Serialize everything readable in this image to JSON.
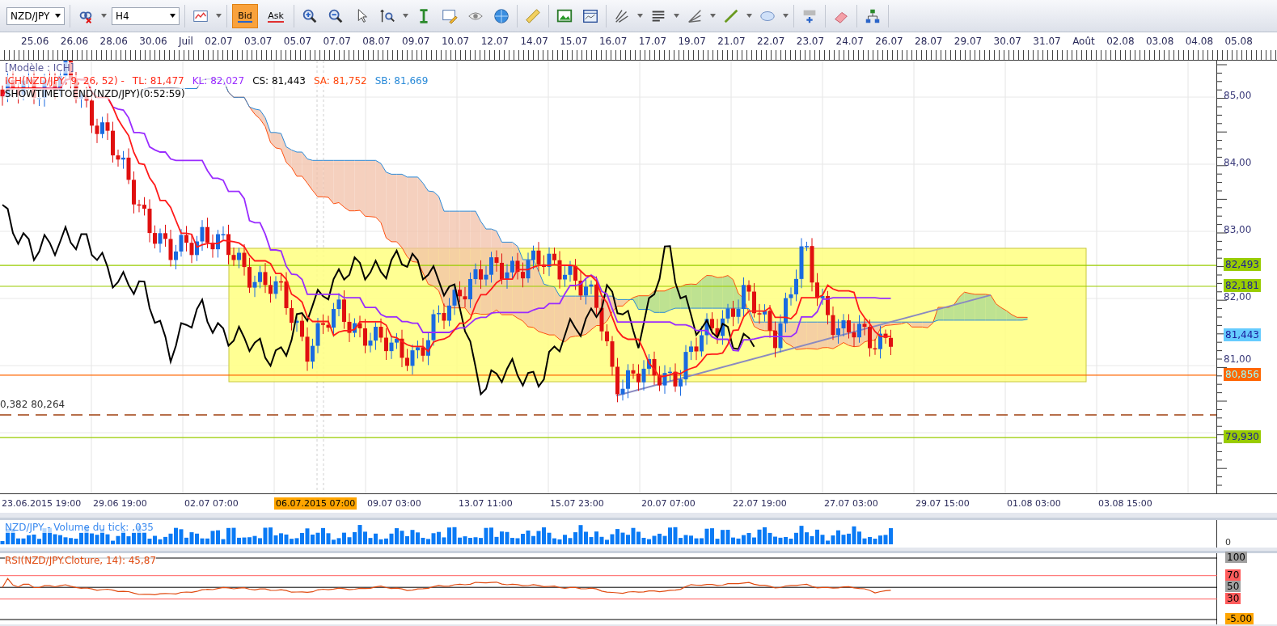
{
  "toolbar": {
    "symbol": "NZD/JPY",
    "timeframe": "H4",
    "price_buttons": [
      {
        "label": "Bid",
        "selected": true
      },
      {
        "label": "Ask",
        "selected": false
      }
    ]
  },
  "date_axis": [
    "25.06",
    "26.06",
    "28.06",
    "30.06",
    "Juil",
    "02.07",
    "03.07",
    "05.07",
    "07.07",
    "08.07",
    "09.07",
    "10.07",
    "12.07",
    "14.07",
    "15.07",
    "16.07",
    "17.07",
    "19.07",
    "21.07",
    "22.07",
    "23.07",
    "24.07",
    "26.07",
    "28.07",
    "29.07",
    "30.07",
    "31.07",
    "Août",
    "02.08",
    "03.08",
    "04.08",
    "05.08"
  ],
  "legend": {
    "template": "[Modèle : ICH]",
    "values": [
      {
        "text": "ICH(NZD/JPY, 9, 26, 52) -",
        "color": "#ff2a1a"
      },
      {
        "text": "TL: 81,477",
        "color": "#ff2a1a"
      },
      {
        "text": "KL: 82,027",
        "color": "#9a2cff"
      },
      {
        "text": "CS: 81,443",
        "color": "#000000"
      },
      {
        "text": "SA: 81,752",
        "color": "#ff4a10"
      },
      {
        "text": "SB: 81,669",
        "color": "#2a8ad8"
      }
    ],
    "timer": "SHOWTIMETOEND(NZD/JPY)(0:52:59)"
  },
  "price_axis": [
    "85,00",
    "84,00",
    "83,00",
    "82,00",
    "81,00"
  ],
  "price_levels": [
    {
      "text": "82,493",
      "color": "#99cc00"
    },
    {
      "text": "82,181",
      "color": "#99cc00"
    },
    {
      "text": "81,443",
      "color": "#66ccff"
    },
    {
      "text": "80,856",
      "color": "#ff6600"
    },
    {
      "text": "79,930",
      "color": "#99cc00"
    }
  ],
  "fibo_label": "0,382 80,264",
  "time_axis": [
    {
      "text": "23.06.2015 19:00",
      "selected": false
    },
    {
      "text": "29.06 19:00",
      "selected": false
    },
    {
      "text": "02.07 07:00",
      "selected": false
    },
    {
      "text": "06.07.2015 07:00",
      "selected": true
    },
    {
      "text": "09.07 03:00",
      "selected": false
    },
    {
      "text": "13.07 11:00",
      "selected": false
    },
    {
      "text": "15.07 23:00",
      "selected": false
    },
    {
      "text": "20.07 07:00",
      "selected": false
    },
    {
      "text": "22.07 19:00",
      "selected": false
    },
    {
      "text": "27.07 03:00",
      "selected": false
    },
    {
      "text": "29.07 15:00",
      "selected": false
    },
    {
      "text": "01.08 03:00",
      "selected": false
    },
    {
      "text": "03.08 15:00",
      "selected": false
    }
  ],
  "volume_panel": {
    "title": "NZD/JPY - Volume du tick: ,035",
    "axis": [
      "0"
    ]
  },
  "rsi_panel": {
    "title": "RSI(NZD/JPY.Cloture, 14): 45,87",
    "axis": [
      {
        "text": "100",
        "color": "#a0a0a0"
      },
      {
        "text": "70",
        "color": "#ff5c5c"
      },
      {
        "text": "50",
        "color": "#a0a0a0"
      },
      {
        "text": "30",
        "color": "#ff5c5c"
      },
      {
        "text": "-5.00",
        "color": "#ffa500"
      }
    ]
  }
}
